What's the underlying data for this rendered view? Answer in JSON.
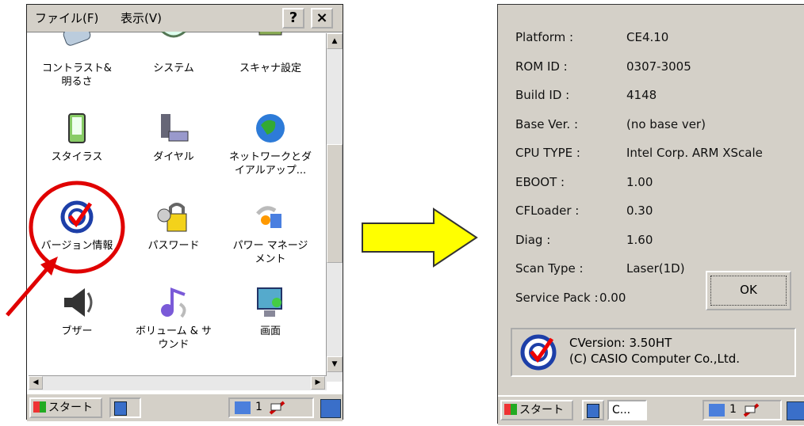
{
  "left_screen": {
    "menu": {
      "file": "ファイル(F)",
      "view": "表示(V)",
      "help_btn": "?",
      "close_btn": "×"
    },
    "icons": [
      {
        "label": "コントラスト&\n明るさ",
        "icon": "contrast-icon"
      },
      {
        "label": "システム",
        "icon": "system-icon"
      },
      {
        "label": "スキャナ設定",
        "icon": "scanner-settings-icon"
      },
      {
        "label": "スタイラス",
        "icon": "stylus-icon"
      },
      {
        "label": "ダイヤル",
        "icon": "dial-icon"
      },
      {
        "label": "ネットワークとダ\nイアルアップ...",
        "icon": "network-icon"
      },
      {
        "label": "バージョン情報",
        "icon": "version-info-icon"
      },
      {
        "label": "パスワード",
        "icon": "password-icon"
      },
      {
        "label": "パワー マネージ\nメント",
        "icon": "power-management-icon"
      },
      {
        "label": "ブザー",
        "icon": "buzzer-icon"
      },
      {
        "label": "ボリューム & サ\nウンド",
        "icon": "volume-sound-icon"
      },
      {
        "label": "画面",
        "icon": "display-icon"
      }
    ],
    "taskbar": {
      "start": "スタート",
      "indicator": "1"
    }
  },
  "right_screen": {
    "info": [
      {
        "label": "Platform :",
        "value": "CE4.10"
      },
      {
        "label": "ROM ID :",
        "value": "0307-3005"
      },
      {
        "label": "Build ID :",
        "value": "4148"
      },
      {
        "label": "Base Ver. :",
        "value": "(no base ver)"
      },
      {
        "label": "CPU TYPE :",
        "value": "Intel Corp. ARM XScale"
      },
      {
        "label": "EBOOT :",
        "value": "1.00"
      },
      {
        "label": "CFLoader :",
        "value": "0.30"
      },
      {
        "label": "Diag :",
        "value": "1.60"
      },
      {
        "label": "Scan Type :",
        "value": "Laser(1D)"
      },
      {
        "label": "Service Pack :",
        "value": "0.00"
      }
    ],
    "ok": "OK",
    "cversion": "CVersion: 3.50HT",
    "copyright": "(C) CASIO Computer Co.,Ltd.",
    "taskbar": {
      "start": "スタート",
      "window": "C...",
      "indicator": "1"
    }
  }
}
